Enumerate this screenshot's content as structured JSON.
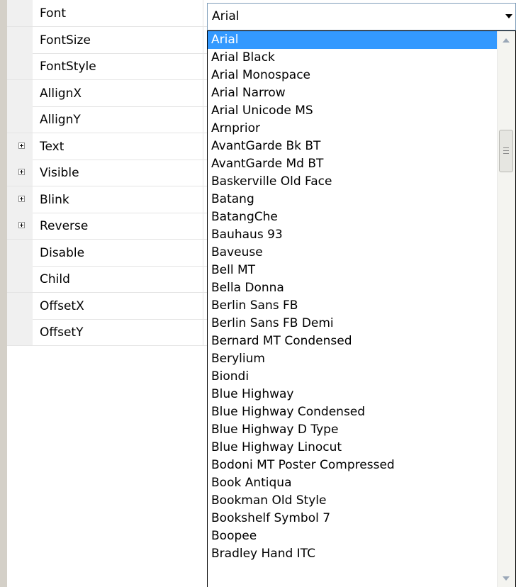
{
  "properties": [
    {
      "name": "Font",
      "expandable": false
    },
    {
      "name": "FontSize",
      "expandable": false
    },
    {
      "name": "FontStyle",
      "expandable": false
    },
    {
      "name": "AllignX",
      "expandable": false
    },
    {
      "name": "AllignY",
      "expandable": false
    },
    {
      "name": "Text",
      "expandable": true
    },
    {
      "name": "Visible",
      "expandable": true
    },
    {
      "name": "Blink",
      "expandable": true
    },
    {
      "name": "Reverse",
      "expandable": true
    },
    {
      "name": "Disable",
      "expandable": false
    },
    {
      "name": "Child",
      "expandable": false
    },
    {
      "name": "OffsetX",
      "expandable": false
    },
    {
      "name": "OffsetY",
      "expandable": false
    }
  ],
  "font_dropdown": {
    "value": "Arial",
    "selected_index": 0,
    "options": [
      "Arial",
      "Arial Black",
      "Arial Monospace",
      "Arial Narrow",
      "Arial Unicode MS",
      "Arnprior",
      "AvantGarde Bk BT",
      "AvantGarde Md BT",
      "Baskerville Old Face",
      "Batang",
      "BatangChe",
      "Bauhaus 93",
      "Baveuse",
      "Bell MT",
      "Bella Donna",
      "Berlin Sans FB",
      "Berlin Sans FB Demi",
      "Bernard MT Condensed",
      "Berylium",
      "Biondi",
      "Blue Highway",
      "Blue Highway Condensed",
      "Blue Highway D Type",
      "Blue Highway Linocut",
      "Bodoni MT Poster Compressed",
      "Book Antiqua",
      "Bookman Old Style",
      "Bookshelf Symbol 7",
      "Boopee",
      "Bradley Hand ITC"
    ]
  },
  "colors": {
    "selection": "#3399ff",
    "combo_border": "#7f9db9"
  }
}
